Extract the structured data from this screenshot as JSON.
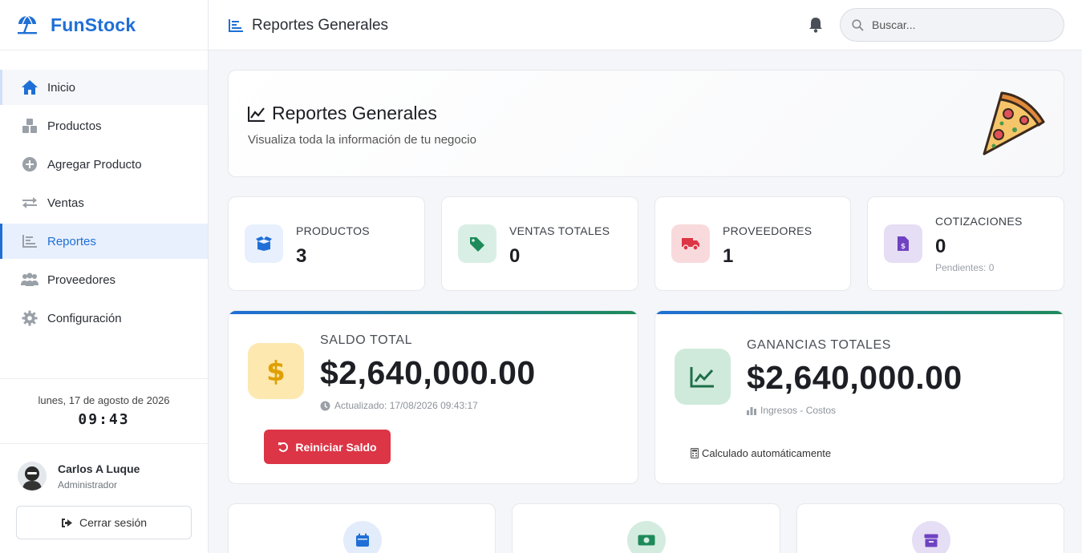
{
  "brand": {
    "name": "FunStock"
  },
  "sidebar": {
    "items": [
      {
        "label": "Inicio",
        "icon": "home-icon"
      },
      {
        "label": "Productos",
        "icon": "boxes-icon"
      },
      {
        "label": "Agregar Producto",
        "icon": "plus-circle-icon"
      },
      {
        "label": "Ventas",
        "icon": "exchange-icon"
      },
      {
        "label": "Reportes",
        "icon": "chart-icon"
      },
      {
        "label": "Proveedores",
        "icon": "users-icon"
      },
      {
        "label": "Configuración",
        "icon": "gear-icon"
      }
    ],
    "active_index": 4
  },
  "clock": {
    "date": "lunes, 17 de agosto de 2026",
    "time": "09:43"
  },
  "user": {
    "name": "Carlos A Luque",
    "role": "Administrador"
  },
  "logout_label": "Cerrar sesión",
  "topbar": {
    "title": "Reportes Generales",
    "search_placeholder": "Buscar..."
  },
  "hero": {
    "title": "Reportes Generales",
    "subtitle": "Visualiza toda la información de tu negocio"
  },
  "stats": [
    {
      "label": "PRODUCTOS",
      "value": "3",
      "color": "#1f6fd6",
      "bg": "#e7f0fc"
    },
    {
      "label": "VENTAS TOTALES",
      "value": "0",
      "color": "#1e8a5a",
      "bg": "#d9efe5"
    },
    {
      "label": "PROVEEDORES",
      "value": "1",
      "color": "#dc3545",
      "bg": "#f8dadd"
    },
    {
      "label": "COTIZACIONES",
      "value": "0",
      "note": "Pendientes: 0",
      "color": "#6f42c1",
      "bg": "#e6def5"
    }
  ],
  "saldo": {
    "label": "SALDO TOTAL",
    "value": "$2,640,000.00",
    "updated": "Actualizado: 17/08/2026 09:43:17",
    "button": "Reiniciar Saldo"
  },
  "ganancias": {
    "label": "GANANCIAS TOTALES",
    "value": "$2,640,000.00",
    "formula": "Ingresos - Costos",
    "note": "Calculado automáticamente"
  },
  "colors": {
    "primary": "#1f6fd6",
    "success": "#1e8a5a",
    "danger": "#dc3545",
    "warning": "#f0ad00",
    "purple": "#6f42c1"
  }
}
